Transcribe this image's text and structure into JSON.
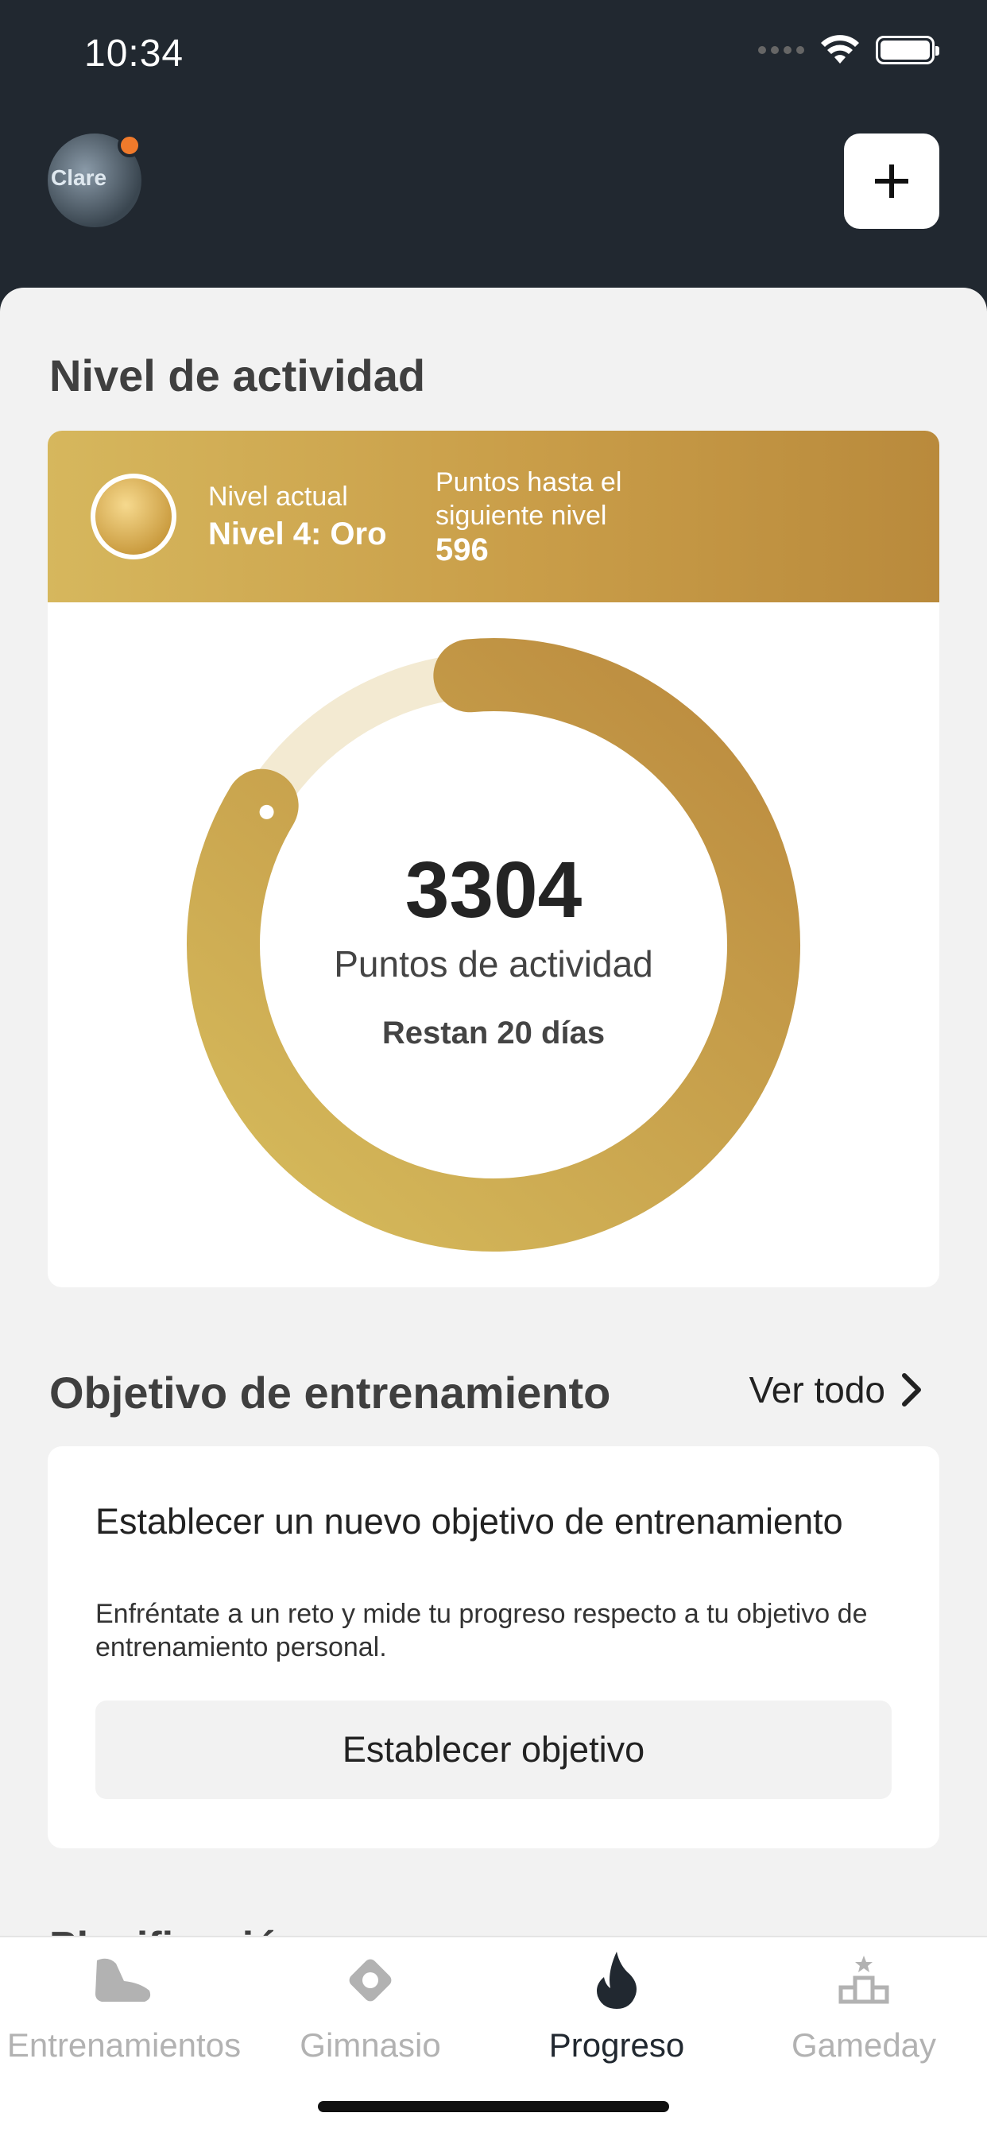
{
  "status_bar": {
    "time": "10:34"
  },
  "header": {
    "avatar_text": "Clare"
  },
  "activity": {
    "section_title": "Nivel de actividad",
    "current_level_label": "Nivel actual",
    "current_level_value": "Nivel 4: Oro",
    "points_to_next_label": "Puntos hasta el siguiente nivel",
    "points_to_next_value": "596",
    "points": "3304",
    "points_caption": "Puntos de actividad",
    "days_remaining": "Restan 20 días",
    "progress_fraction": 0.85,
    "colors": {
      "gold_light": "#d6bb5c",
      "gold_dark": "#bb8a3e",
      "track": "#f3ead2"
    }
  },
  "goal": {
    "section_title": "Objetivo de entrenamiento",
    "see_all": "Ver todo",
    "card_title": "Establecer un nuevo objetivo de entrenamiento",
    "card_desc": "Enfréntate a un reto y mide tu progreso respecto a tu objetivo de entrenamiento personal.",
    "button_label": "Establecer objetivo"
  },
  "next_section_peek": "Planificación",
  "tabs": [
    {
      "label": "Entrenamientos",
      "icon": "shoe-icon",
      "active": false
    },
    {
      "label": "Gimnasio",
      "icon": "location-pin-icon",
      "active": false
    },
    {
      "label": "Progreso",
      "icon": "flame-icon",
      "active": true
    },
    {
      "label": "Gameday",
      "icon": "podium-icon",
      "active": false
    }
  ]
}
